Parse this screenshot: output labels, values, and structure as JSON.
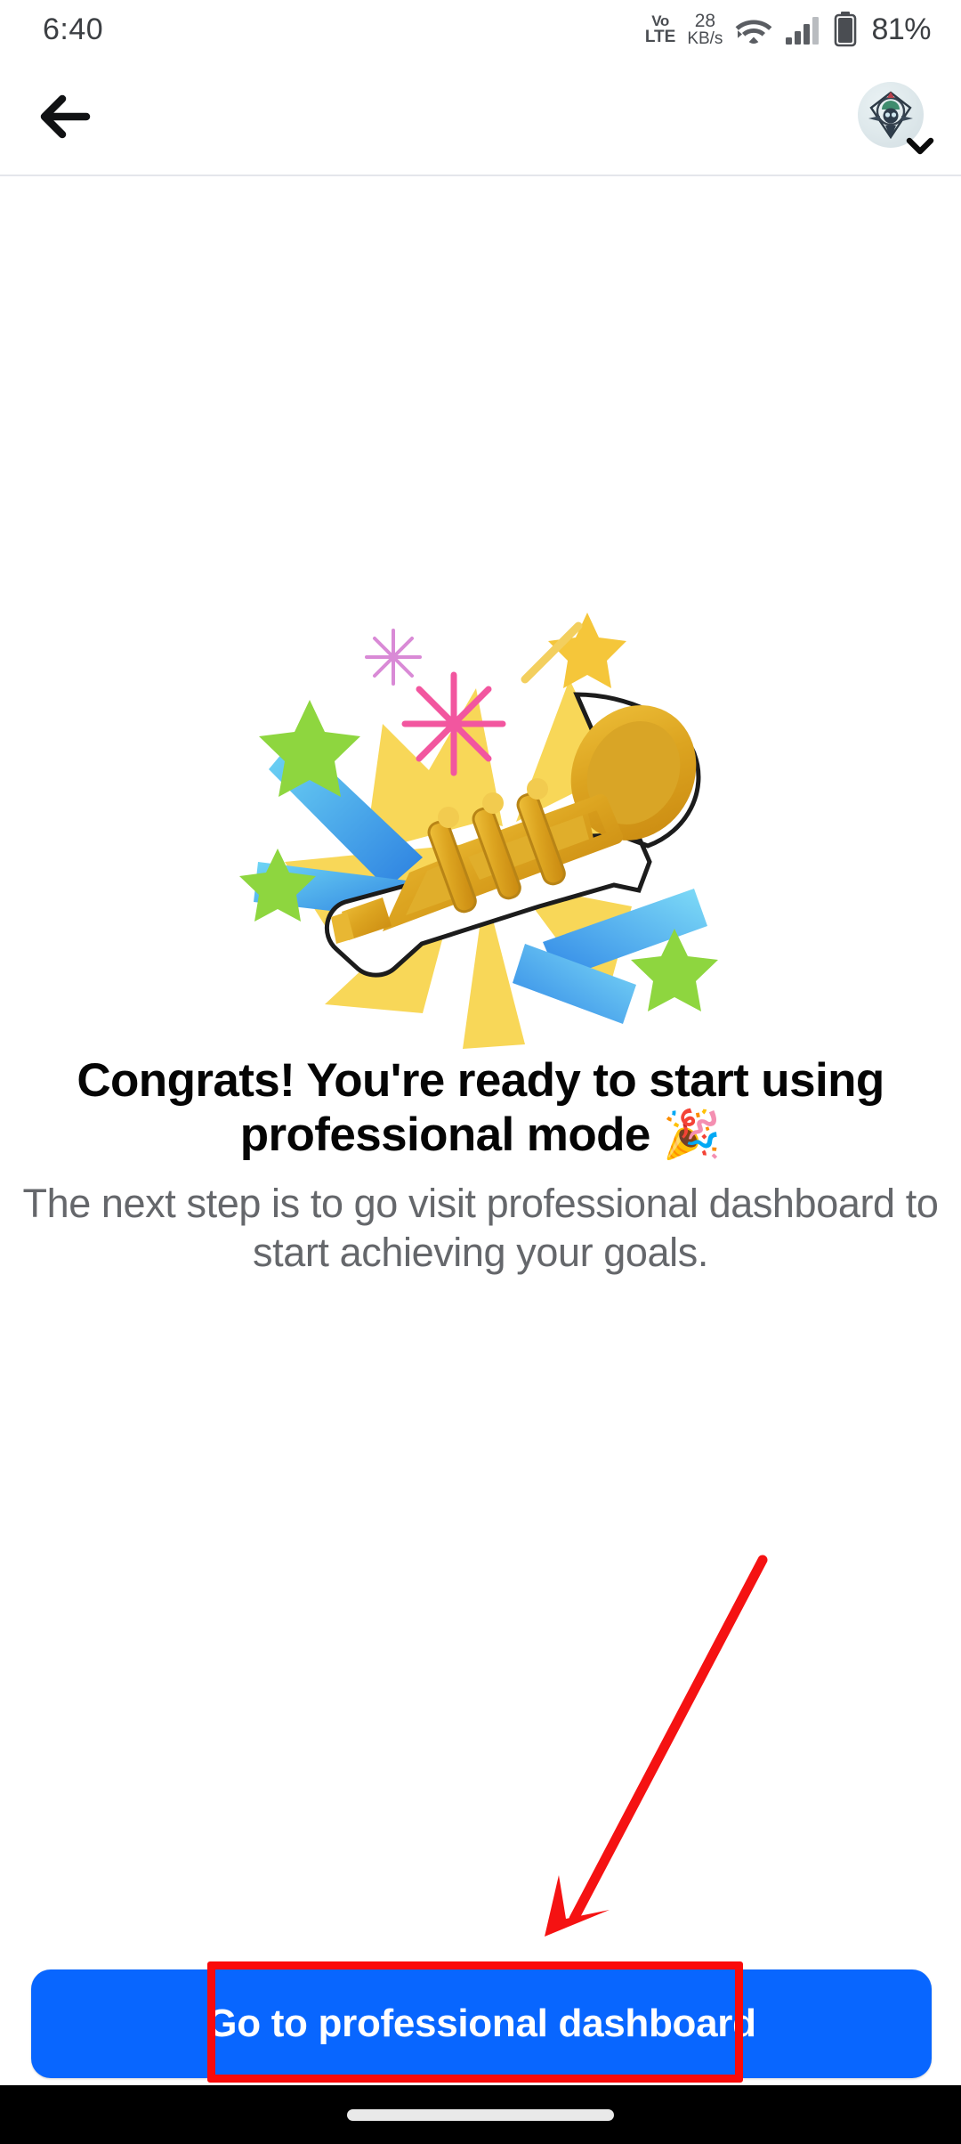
{
  "status_bar": {
    "time": "6:40",
    "network_type_top": "Vo",
    "network_type_bottom": "LTE",
    "data_rate_value": "28",
    "data_rate_unit": "KB/s",
    "wifi_icon": "wifi-icon",
    "signal_icon": "cellular-signal-icon",
    "battery_icon": "battery-icon",
    "battery_percent": "81%"
  },
  "header": {
    "back_icon": "back-arrow-icon",
    "avatar_name": "profile-avatar",
    "chevron_icon": "chevron-down-icon"
  },
  "main": {
    "illustration_name": "trumpet-celebration-illustration",
    "heading": "Congrats! You're ready to start using professional mode 🎉",
    "subheading": "The next step is to go visit professional dashboard to start achieving your goals."
  },
  "cta": {
    "label": "Go to professional dashboard",
    "color": "#0866ff",
    "text_color": "#ffffff"
  },
  "annotation": {
    "highlight_color": "#fa0a0a",
    "arrow_name": "red-pointer-arrow",
    "box_name": "red-highlight-box"
  },
  "nav_bar": {
    "pill_name": "gesture-home-pill"
  },
  "colors": {
    "brand_blue": "#0866ff",
    "text_primary": "#050505",
    "text_secondary": "#65676b",
    "divider": "#e4e6eb",
    "annotation_red": "#fa0a0a"
  }
}
